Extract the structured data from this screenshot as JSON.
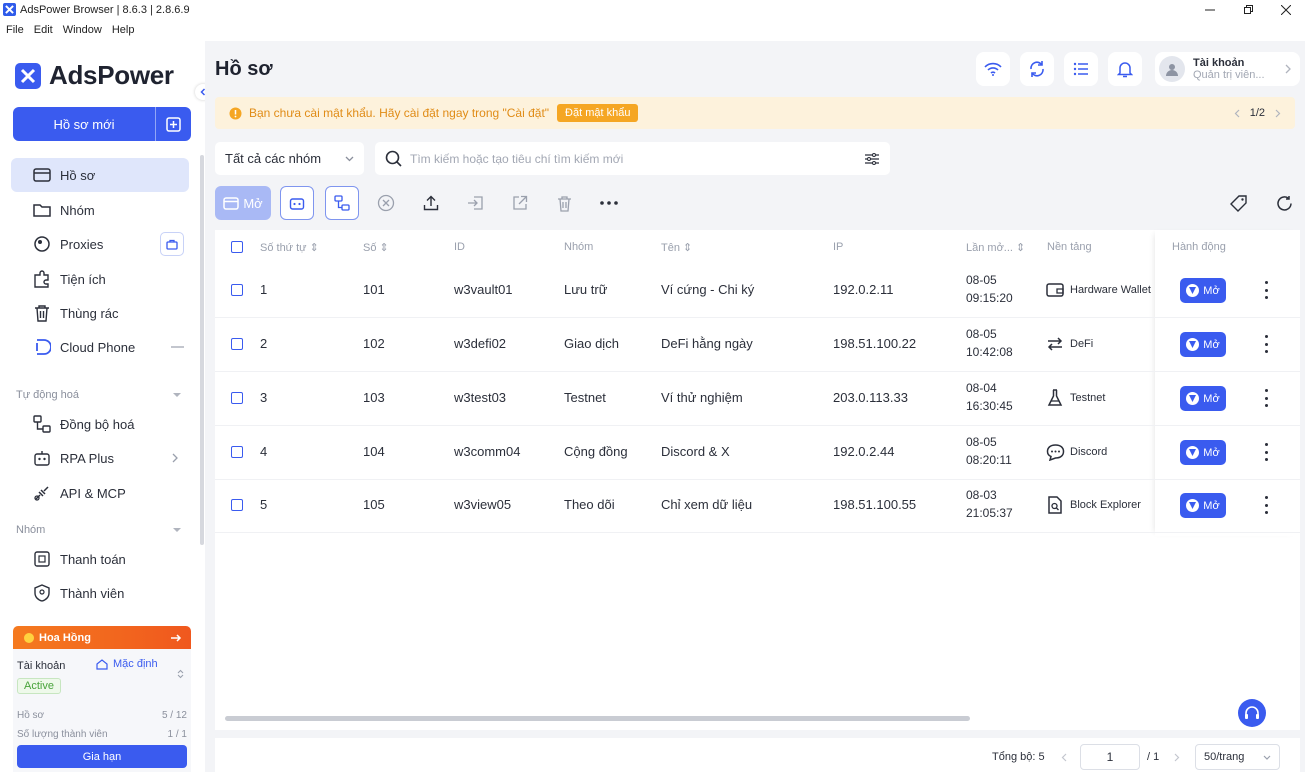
{
  "window": {
    "title": "AdsPower Browser | 8.6.3 | 2.8.6.9"
  },
  "menu": [
    "File",
    "Edit",
    "Window",
    "Help"
  ],
  "brand": {
    "name": "AdsPower",
    "accent": "#3a5bef"
  },
  "sidebar": {
    "new_profile_label": "Hồ sơ mới",
    "items": [
      {
        "label": "Hồ sơ",
        "icon": "profile-icon"
      },
      {
        "label": "Nhóm",
        "icon": "folder-icon"
      },
      {
        "label": "Proxies",
        "icon": "proxy-icon"
      },
      {
        "label": "Tiện ích",
        "icon": "extension-icon"
      },
      {
        "label": "Thùng rác",
        "icon": "trash-icon"
      },
      {
        "label": "Cloud Phone",
        "icon": "cloud-phone-icon"
      }
    ],
    "automation_section": "Tự động hoá",
    "automation_items": [
      {
        "label": "Đồng bộ hoá",
        "icon": "sync-icon"
      },
      {
        "label": "RPA Plus",
        "icon": "robot-icon"
      },
      {
        "label": "API & MCP",
        "icon": "api-icon"
      }
    ],
    "team_section": "Nhóm",
    "team_items": [
      {
        "label": "Thanh toán",
        "icon": "billing-icon"
      },
      {
        "label": "Thành viên",
        "icon": "member-icon"
      }
    ],
    "promo_label": "Hoa Hồng",
    "account": {
      "label": "Tài khoản",
      "plan": "Mặc định",
      "status": "Active",
      "profiles_label": "Hồ sơ",
      "profiles_value": "5 / 12",
      "members_label": "Số lượng thành viên",
      "members_value": "1 / 1",
      "renew_label": "Gia hạn"
    }
  },
  "header": {
    "title": "Hồ sơ",
    "user_name": "Tài khoản",
    "user_role": "Quản trị viên..."
  },
  "banner": {
    "text": "Bạn chưa cài mật khẩu. Hãy cài đặt ngay trong \"Cài đặt\"",
    "button": "Đặt mật khẩu",
    "pager": "1/2"
  },
  "filter": {
    "group_select": "Tất cả các nhóm",
    "search_placeholder": "Tìm kiếm hoặc tạo tiêu chí tìm kiếm mới"
  },
  "toolbar": {
    "open_label": "Mở"
  },
  "table": {
    "headers": {
      "seq": "Số thứ tự",
      "no": "Số",
      "id": "ID",
      "group": "Nhóm",
      "name": "Tên",
      "ip": "IP",
      "last_open": "Lần mở...",
      "platform": "Nền tảng",
      "action": "Hành động"
    },
    "open_label": "Mở",
    "rows": [
      {
        "seq": "1",
        "no": "101",
        "id": "w3vault01",
        "group": "Lưu trữ",
        "name": "Ví cứng - Chi ký",
        "ip": "192.0.2.11",
        "date": "08-05",
        "time": "09:15:20",
        "platform": "Hardware Wallet"
      },
      {
        "seq": "2",
        "no": "102",
        "id": "w3defi02",
        "group": "Giao dịch",
        "name": "DeFi hằng ngày",
        "ip": "198.51.100.22",
        "date": "08-05",
        "time": "10:42:08",
        "platform": "DeFi"
      },
      {
        "seq": "3",
        "no": "103",
        "id": "w3test03",
        "group": "Testnet",
        "name": "Ví thử nghiệm",
        "ip": "203.0.113.33",
        "date": "08-04",
        "time": "16:30:45",
        "platform": "Testnet"
      },
      {
        "seq": "4",
        "no": "104",
        "id": "w3comm04",
        "group": "Cộng đồng",
        "name": "Discord & X",
        "ip": "192.0.2.44",
        "date": "08-05",
        "time": "08:20:11",
        "platform": "Discord"
      },
      {
        "seq": "5",
        "no": "105",
        "id": "w3view05",
        "group": "Theo dõi",
        "name": "Chỉ xem dữ liệu",
        "ip": "198.51.100.55",
        "date": "08-03",
        "time": "21:05:37",
        "platform": "Block Explorer"
      }
    ]
  },
  "footer": {
    "total": "Tổng bộ: 5",
    "page_input": "1",
    "page_total": "/ 1",
    "page_size": "50/trang"
  }
}
